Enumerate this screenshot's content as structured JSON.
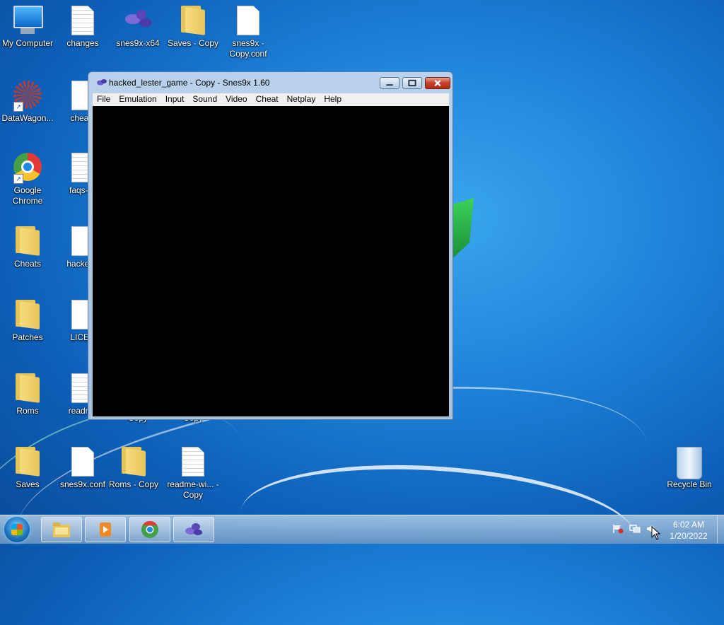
{
  "desktop": {
    "icons": [
      {
        "label": "My Computer"
      },
      {
        "label": "changes"
      },
      {
        "label": "snes9x-x64"
      },
      {
        "label": "Saves - Copy"
      },
      {
        "label": "snes9x - Copy.conf"
      },
      {
        "label": "DataWagon..."
      },
      {
        "label": "cheats"
      },
      {
        "label": "Google Chrome"
      },
      {
        "label": "faqs-wi"
      },
      {
        "label": "Cheats"
      },
      {
        "label": "hacked_"
      },
      {
        "label": "Patches"
      },
      {
        "label": "LICEN"
      },
      {
        "label": "Roms"
      },
      {
        "label": "readme"
      },
      {
        "label": "Saves"
      },
      {
        "label": "snes9x.conf"
      },
      {
        "label": "Roms - Copy"
      },
      {
        "label": "readme-wi... - Copy"
      },
      {
        "label": "Recycle Bin"
      },
      {
        "label": "Copy"
      },
      {
        "label": "Copy"
      }
    ]
  },
  "window": {
    "title": "hacked_lester_game - Copy - Snes9x 1.60",
    "menu": [
      "File",
      "Emulation",
      "Input",
      "Sound",
      "Video",
      "Cheat",
      "Netplay",
      "Help"
    ]
  },
  "taskbar": {
    "items": [
      "start",
      "explorer",
      "media-player",
      "chrome",
      "snes9x"
    ],
    "time": "6:02 AM",
    "date": "1/20/2022"
  }
}
